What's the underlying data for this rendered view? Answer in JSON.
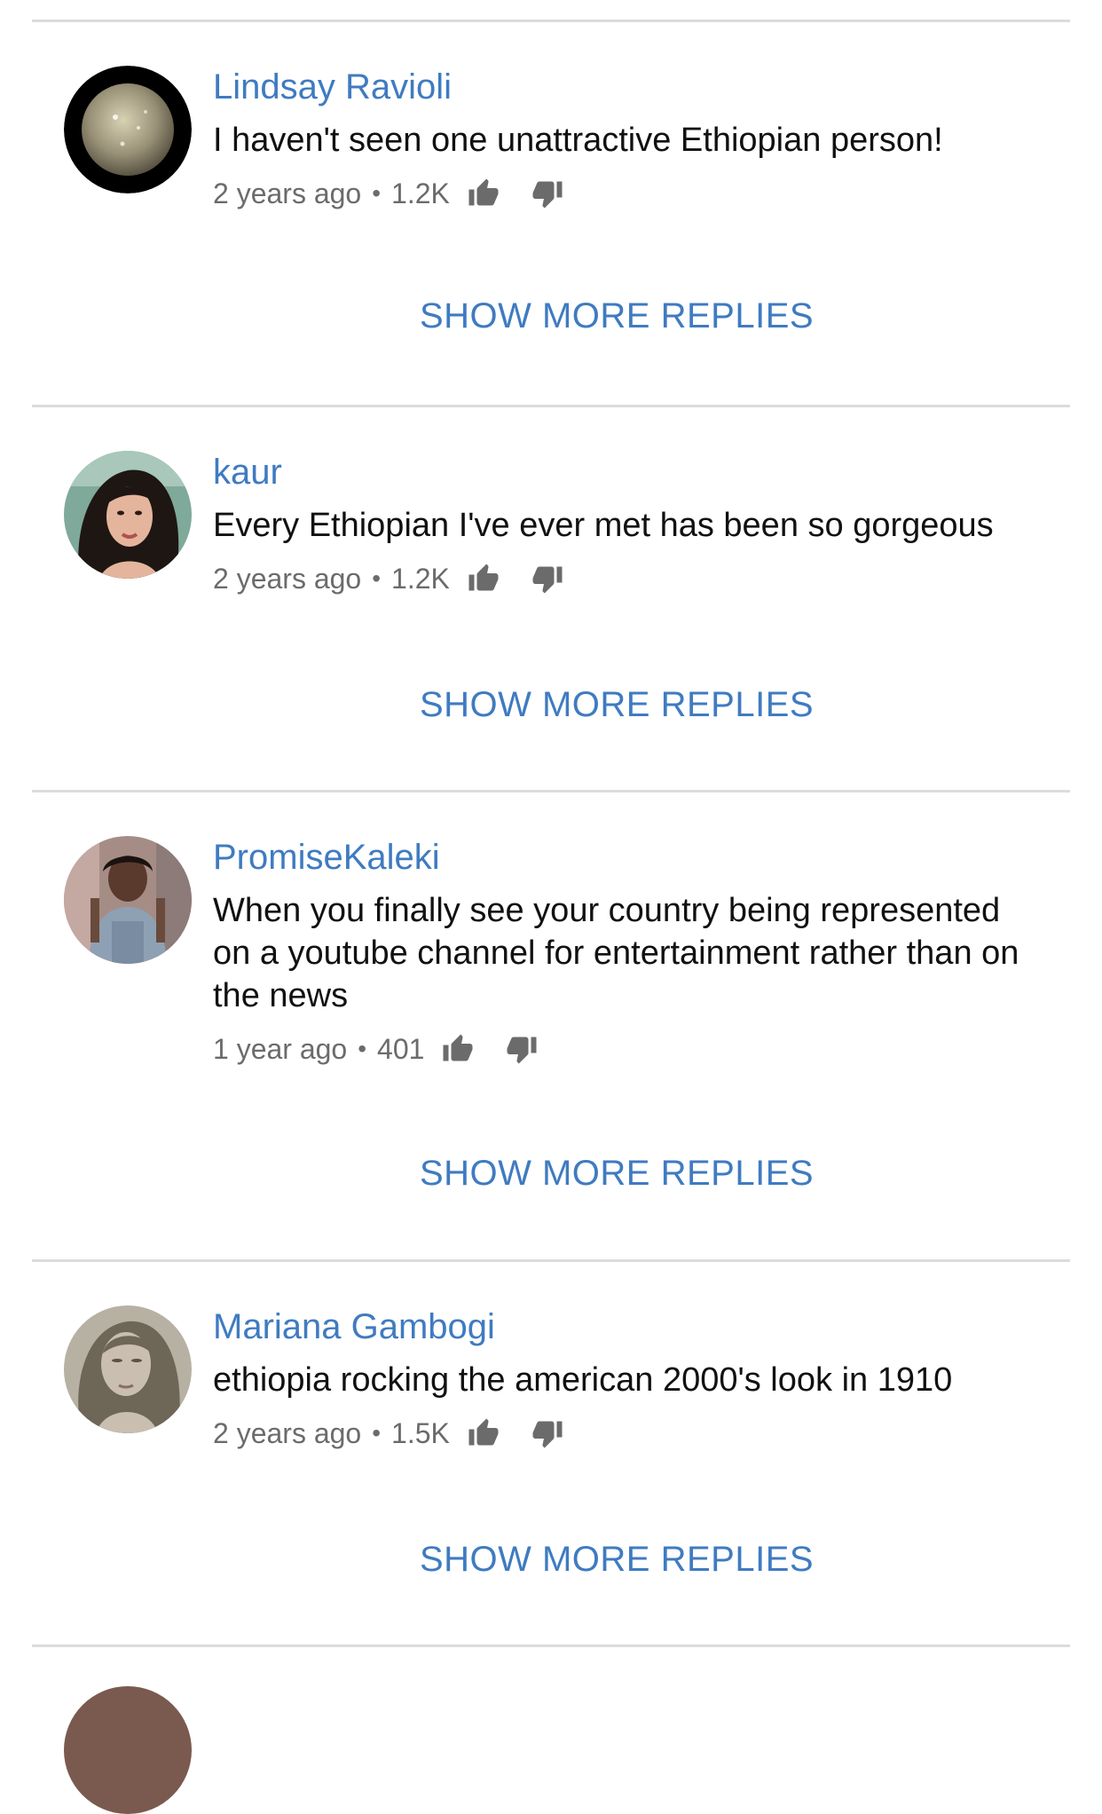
{
  "colors": {
    "link_blue": "#3f7bc1",
    "text_dark": "#111111",
    "meta_gray": "#6b6b6b",
    "divider": "#dcdcdc"
  },
  "icons": {
    "like": "thumb-up-icon",
    "dislike": "thumb-down-icon"
  },
  "comments": [
    {
      "author": "Lindsay Ravioli",
      "text": "I haven't seen one unattractive Ethiopian person!",
      "time": "2 years ago",
      "separator": "•",
      "likes": "1.2K",
      "more_replies": "SHOW MORE REPLIES"
    },
    {
      "author": "kaur",
      "text": "Every Ethiopian I've ever met has been so gorgeous",
      "time": "2 years ago",
      "separator": "•",
      "likes": "1.2K",
      "more_replies": "SHOW MORE REPLIES"
    },
    {
      "author": "PromiseKaleki",
      "text": "When you finally see your country being represented on a youtube channel for entertainment rather than on the news",
      "time": "1 year ago",
      "separator": "•",
      "likes": "401",
      "more_replies": "SHOW MORE REPLIES"
    },
    {
      "author": "Mariana Gambogi",
      "text": "ethiopia rocking the american 2000's look in 1910",
      "time": "2 years ago",
      "separator": "•",
      "likes": "1.5K",
      "more_replies": "SHOW MORE REPLIES"
    }
  ]
}
